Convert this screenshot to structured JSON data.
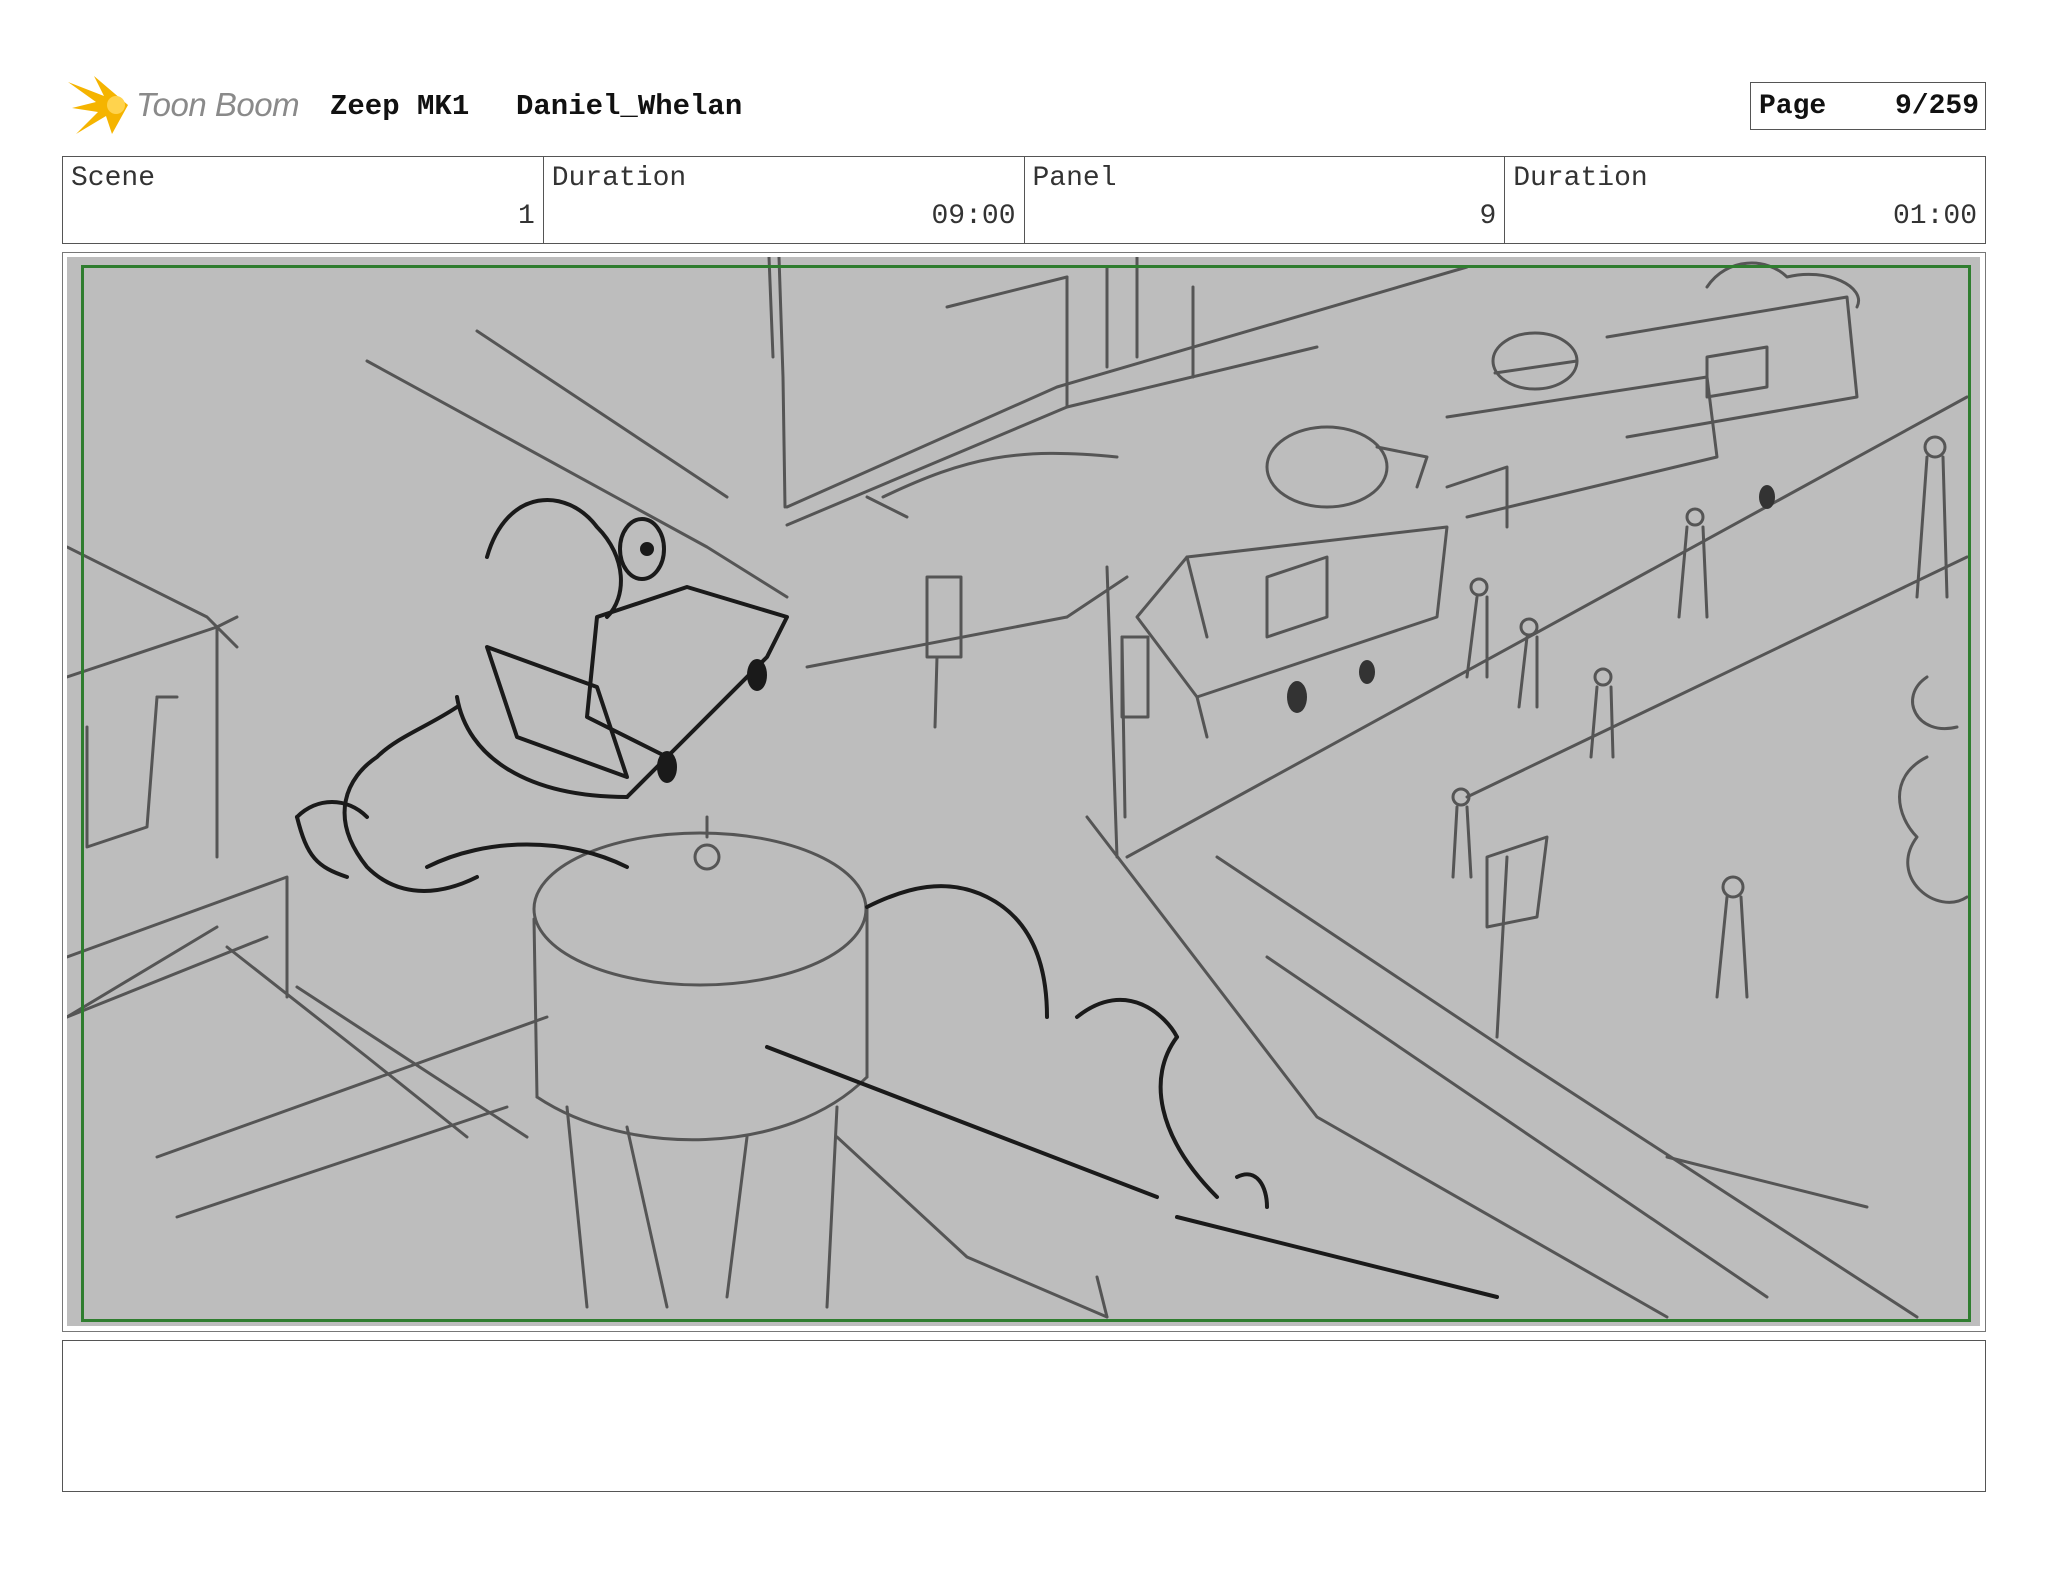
{
  "header": {
    "logo_text": "Toon Boom",
    "project": "Zeep MK1",
    "author": "Daniel_Whelan",
    "page_label": "Page",
    "page_value": "9/259"
  },
  "info": {
    "scene_label": "Scene",
    "scene_value": "1",
    "scene_duration_label": "Duration",
    "scene_duration_value": "09:00",
    "panel_label": "Panel",
    "panel_value": "9",
    "panel_duration_label": "Duration",
    "panel_duration_value": "01:00"
  },
  "colors": {
    "safe_frame": "#2f7d2f",
    "sketch_background": "#bdbdbd",
    "logo_accent": "#f5b400"
  },
  "notes": ""
}
